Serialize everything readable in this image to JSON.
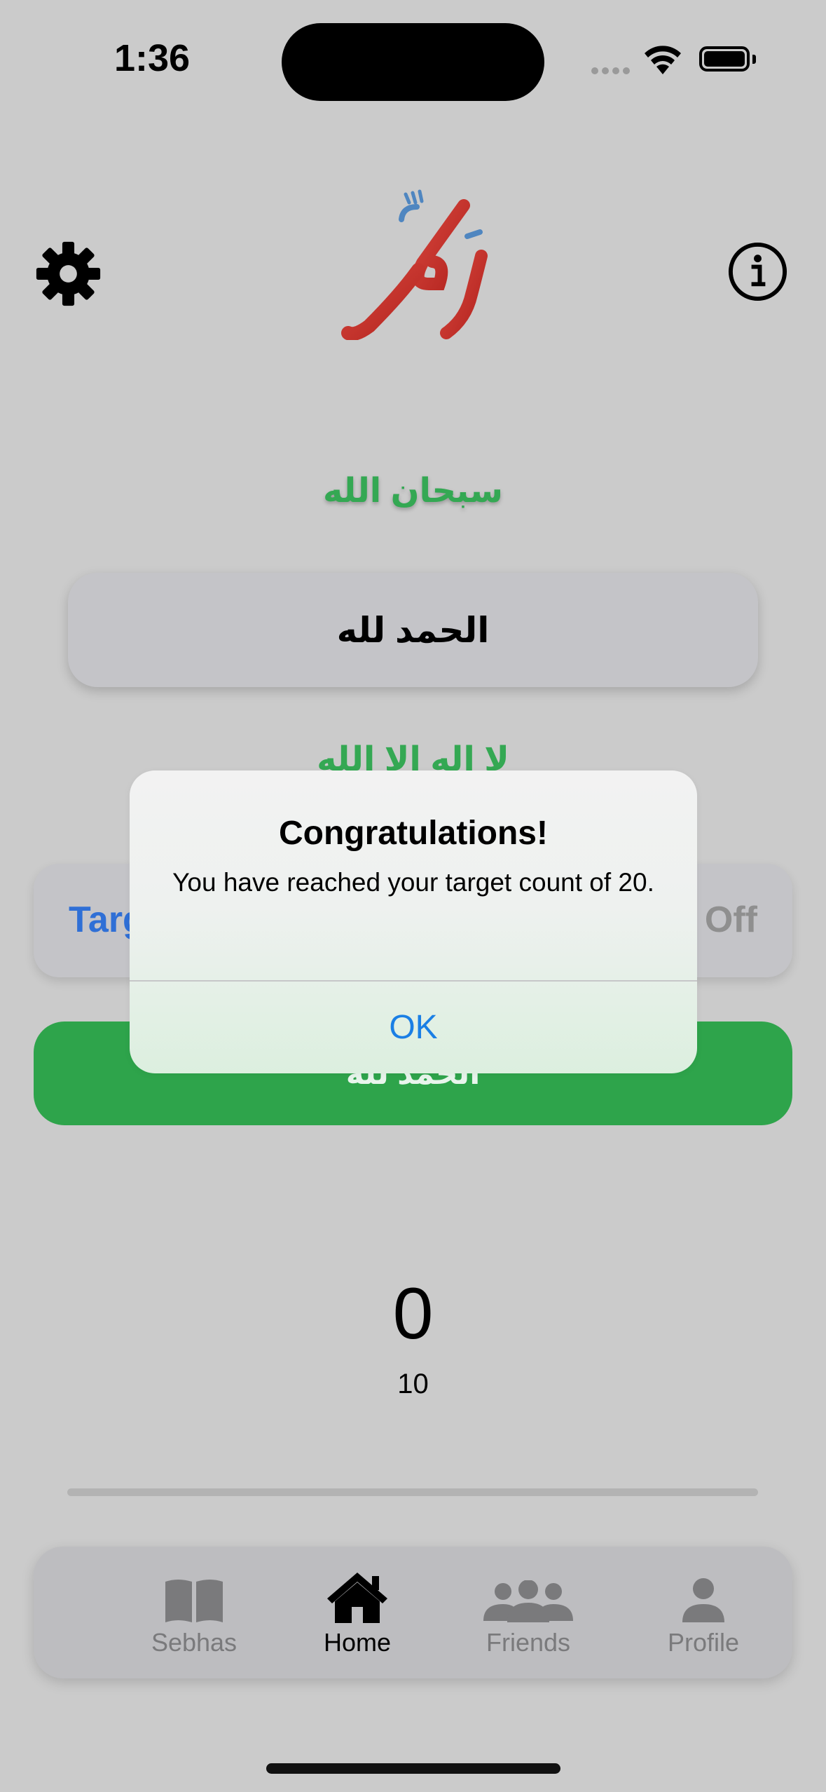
{
  "status_bar": {
    "time": "1:36"
  },
  "header": {
    "settings_icon": "gear-icon",
    "info_icon": "info-circle-icon",
    "logo_icon": "dhikr-calligraphy-logo"
  },
  "dhikr_list": {
    "previous": "سبحان الله",
    "selected": "الحمد لله",
    "next": "لا اله الا الله"
  },
  "target": {
    "label": "Target",
    "toggle_value": "Off"
  },
  "count_button": {
    "label": "الحمد لله"
  },
  "counter": {
    "count": "0",
    "target": "10",
    "progress": 0
  },
  "tab_bar": {
    "items": [
      {
        "label": "Sebhas",
        "icon": "book-icon",
        "active": false
      },
      {
        "label": "Home",
        "icon": "house-icon",
        "active": true
      },
      {
        "label": "Friends",
        "icon": "people-icon",
        "active": false
      },
      {
        "label": "Profile",
        "icon": "person-icon",
        "active": false
      }
    ]
  },
  "alert": {
    "title": "Congratulations!",
    "message": "You have reached your target count of 20.",
    "ok_label": "OK"
  },
  "colors": {
    "accent_green": "#2ea44b",
    "link_blue": "#1a7fe5",
    "target_blue": "#2f6fd6",
    "logo_red": "#c8302a"
  }
}
